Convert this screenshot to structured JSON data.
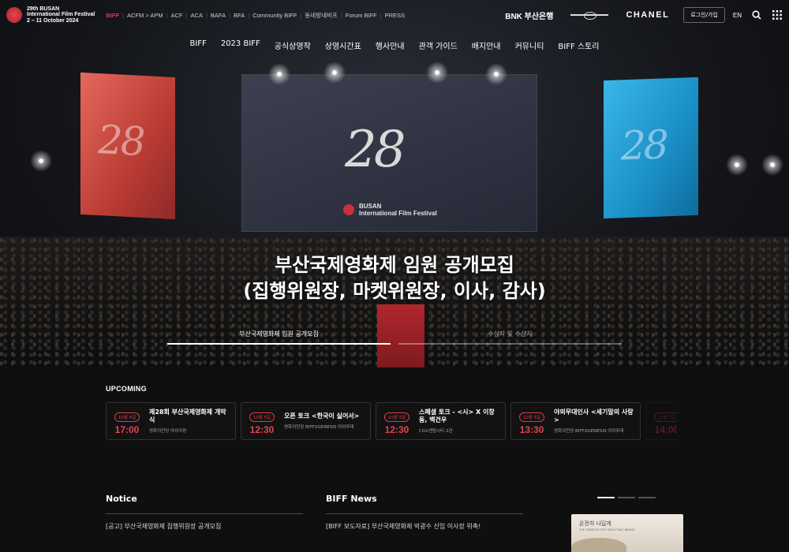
{
  "festival": {
    "logo_text": [
      "29th BUSAN",
      "International Film Festival",
      "2 – 11 October 2024"
    ]
  },
  "topnav": {
    "items": [
      "BIFF",
      "ACFM > APM",
      "ACF",
      "ACA",
      "BAFA",
      "BFA",
      "Community BIFF",
      "동네방네비프",
      "Forum BIFF",
      "PRESS"
    ]
  },
  "sponsors": {
    "bnk": "BNK 부산은행",
    "chanel": "CHANEL"
  },
  "header": {
    "login": "로그인/가입",
    "lang": "EN"
  },
  "mainnav": {
    "items": [
      "BIFF",
      "2023 BIFF",
      "공식상영작",
      "상영시간표",
      "행사안내",
      "관객 가이드",
      "배지안내",
      "커뮤니티",
      "BIFF 스토리"
    ]
  },
  "hero": {
    "title_line1": "부산국제영화제 임원 공개모집",
    "title_line2": "(집행위원장, 마켓위원장, 이사, 감사)",
    "screen_logo": "28",
    "screen_brand_1": "BUSAN",
    "screen_brand_2": "International Film Festival",
    "slides": [
      {
        "label": "부산국제영화제 임원 공개모집",
        "active": true
      },
      {
        "label": "수상작 및 수상자",
        "active": false
      }
    ]
  },
  "upcoming": {
    "title": "UPCOMING",
    "events": [
      {
        "date": "10월 4일",
        "time": "17:00",
        "title": "제28회 부산국제영화제 개막식",
        "venue": "영화의전당 야외극장"
      },
      {
        "date": "10월 5일",
        "time": "12:30",
        "title": "오픈 토크 <한국이 싫어서>",
        "venue": "영화의전당 BIFFXGENESIS 야외무대"
      },
      {
        "date": "10월 5일",
        "time": "12:30",
        "title": "스페셜 토크 - <시> X 이창동, 백건우",
        "venue": "CGV센텀시티 2관"
      },
      {
        "date": "10월 5일",
        "time": "13:30",
        "title": "야외무대인사 <세기말의 사랑>",
        "venue": "영화의전당 BIFFXGENESIS 야외무대"
      },
      {
        "date": "10월 5일",
        "time": "14:00",
        "title": "",
        "venue": ""
      }
    ]
  },
  "notice": {
    "title": "Notice",
    "items": [
      "[공고] 부산국제영화제 집행위원장 공개모집"
    ]
  },
  "news": {
    "title": "BIFF News",
    "items": [
      "[BIFF 보도자료] 부산국제영화제 박광수 신임 이사장 위촉!"
    ]
  },
  "promo": {
    "title": "온전히 나답게",
    "subtitle": "THE GENESIS G70 SHOOTING BRAKE"
  }
}
